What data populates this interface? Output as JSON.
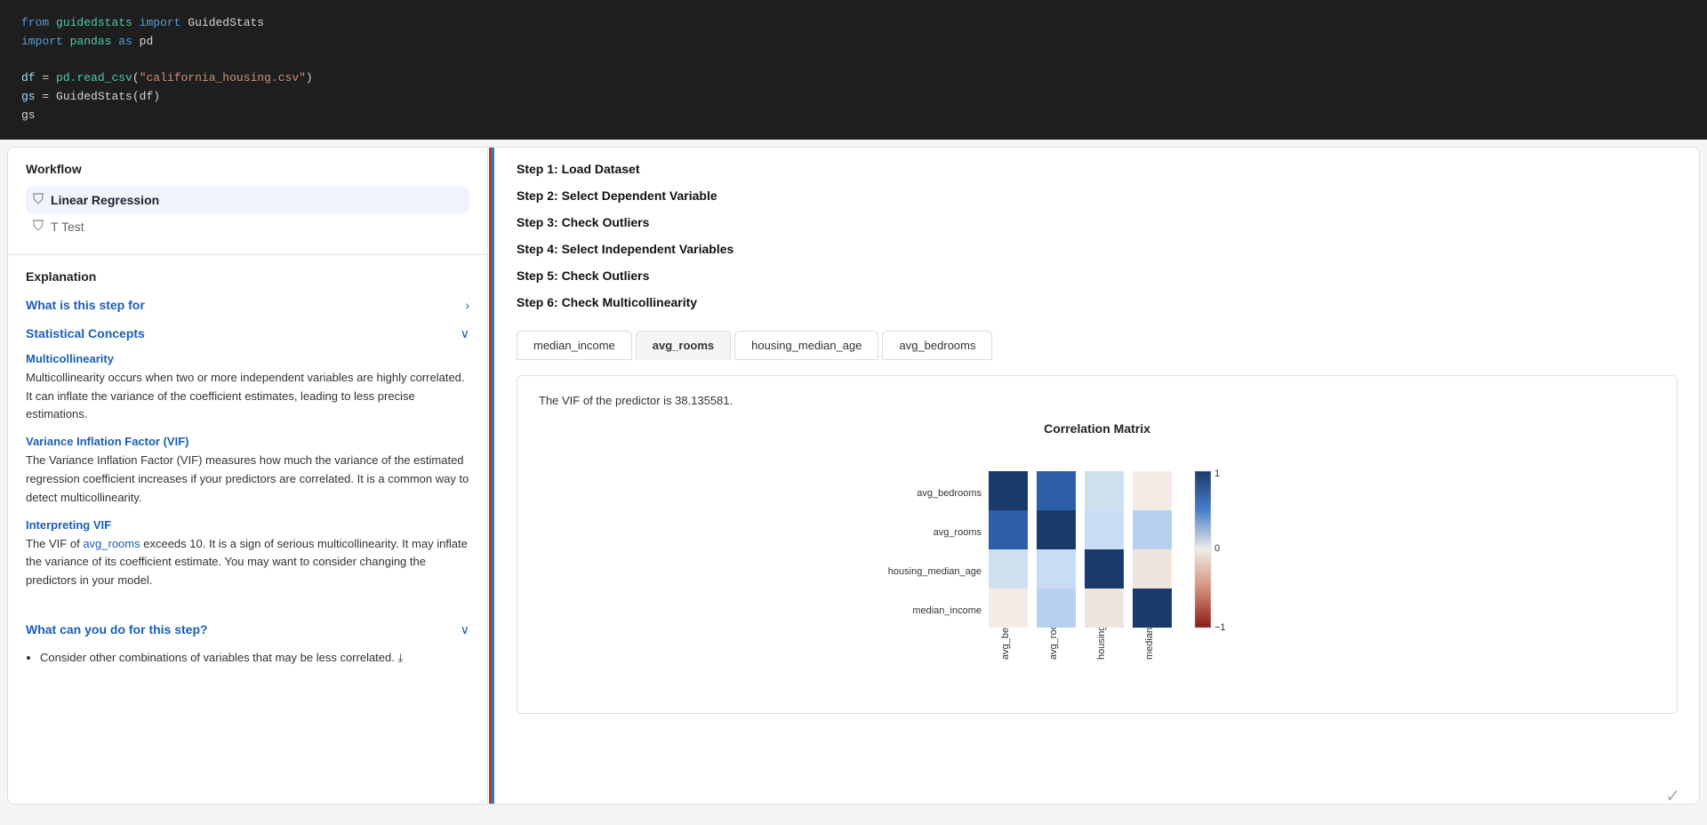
{
  "code": {
    "line1_kw": "from",
    "line1_module": "guidedstats",
    "line1_import": "import",
    "line1_class": "GuidedStats",
    "line2_import": "import",
    "line2_module": "pandas",
    "line2_as": "as",
    "line2_alias": "pd",
    "line3_var": "df",
    "line3_eq": " = ",
    "line3_method": "pd.read_csv",
    "line3_str": "\"california_housing.csv\"",
    "line4_var1": "gs",
    "line4_eq": " = ",
    "line4_class": "GuidedStats",
    "line4_arg": "df",
    "line5": "gs"
  },
  "workflow": {
    "title": "Workflow",
    "items": [
      {
        "label": "Linear Regression",
        "active": true
      },
      {
        "label": "T Test",
        "active": false
      }
    ]
  },
  "explanation": {
    "title": "Explanation",
    "what_is_label": "What is this step for",
    "statistical_concepts_label": "Statistical Concepts",
    "concepts": [
      {
        "title": "Multicollinearity",
        "body": "Multicollinearity occurs when two or more independent variables are highly correlated. It can inflate the variance of the coefficient estimates, leading to less precise estimations."
      },
      {
        "title": "Variance Inflation Factor (VIF)",
        "body": "The Variance Inflation Factor (VIF) measures how much the variance of the estimated regression coefficient increases if your predictors are correlated. It is a common way to detect multicollinearity."
      },
      {
        "title": "Interpreting VIF",
        "body_prefix": "The VIF of ",
        "body_link": "avg_rooms",
        "body_suffix": " exceeds 10. It is a sign of serious multicollinearity. It may inflate the variance of its coefficient estimate. You may want to consider changing the predictors in your model."
      }
    ],
    "what_can_do_label": "What can you do for this step?",
    "what_can_do_items": [
      "Consider other combinations of variables that may be less correlated. ⤓"
    ]
  },
  "steps": [
    {
      "label": "Step 1: Load Dataset"
    },
    {
      "label": "Step 2: Select Dependent Variable"
    },
    {
      "label": "Step 3: Check Outliers"
    },
    {
      "label": "Step 4: Select Independent Variables"
    },
    {
      "label": "Step 5: Check Outliers"
    },
    {
      "label": "Step 6: Check Multicollinearity"
    }
  ],
  "tabs": [
    {
      "label": "median_income",
      "active": false
    },
    {
      "label": "avg_rooms",
      "active": true
    },
    {
      "label": "housing_median_age",
      "active": false
    },
    {
      "label": "avg_bedrooms",
      "active": false
    }
  ],
  "vif": {
    "text": "The VIF of the predictor is 38.135581.",
    "corr_title": "Correlation Matrix",
    "row_labels": [
      "avg_bedrooms",
      "avg_rooms",
      "housing_median_age",
      "median_income"
    ],
    "col_labels": [
      "avg_bedrooms",
      "avg_rooms",
      "housing_median_age",
      "median_income"
    ],
    "legend_top": "1",
    "legend_mid": "0",
    "legend_bottom": "−1"
  },
  "matrix_data": [
    [
      1.0,
      0.85,
      0.1,
      -0.05
    ],
    [
      0.85,
      1.0,
      0.12,
      0.2
    ],
    [
      0.1,
      0.12,
      1.0,
      -0.1
    ],
    [
      -0.05,
      0.2,
      -0.1,
      1.0
    ]
  ],
  "checkmark": "✓"
}
